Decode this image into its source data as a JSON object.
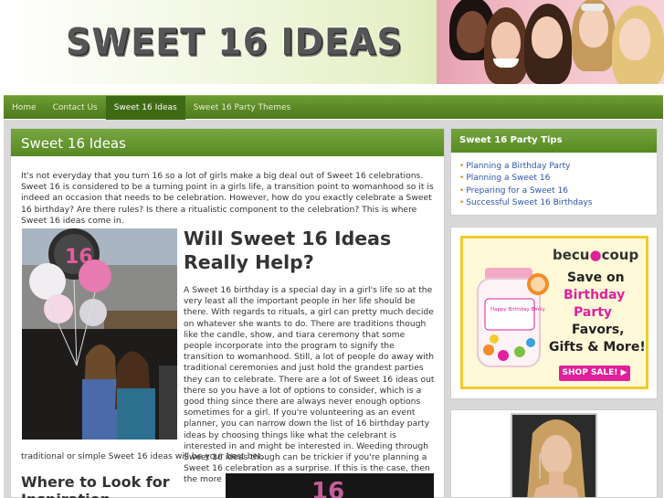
{
  "header": {
    "logo_text": "SWEET 16 IDEAS"
  },
  "nav": {
    "items": [
      {
        "label": "Home",
        "active": false
      },
      {
        "label": "Contact Us",
        "active": false
      },
      {
        "label": "Sweet 16 Ideas",
        "active": true
      },
      {
        "label": "Sweet 16 Party Themes",
        "active": false
      }
    ]
  },
  "main": {
    "title": "Sweet 16 Ideas",
    "intro": "It's not everyday that you turn 16 so a lot of girls make a big deal out of Sweet 16 celebrations. Sweet 16 is considered to be a turning point in a girls life, a transition point to womanhood so it is indeed an occasion that needs to be celebration. However, how do you exactly celebrate a Sweet 16 birthday? Are there rules? Is there a ritualistic component to the celebration? This is where Sweet 16 ideas come in.",
    "heading": "Will Sweet 16 Ideas Really Help?",
    "article": "A Sweet 16 birthday is a special day in a girl's life so at the very least all the important people in her life should be there. With regards to rituals, a girl can pretty much decide on whatever she wants to do. There are traditions though like the candle, show, and tiara ceremony that some people incorporate into the program to signify the transition to womanhood. Still, a lot of people do away with traditional ceremonies and just hold the grandest parties they can to celebrate. There are a lot of Sweet 16 ideas out there so you have a lot of options to consider, which is a good thing since there are always never enough options sometimes for a girl. If you're volunteering as an event planner, you can narrow down the list of 16 birthday party ideas by choosing things like what the celebrant is interested in and might be interested in. Weeding through Sweet 16 ideas though can be trickier if you're planning a Sweet 16 celebration as a surprise. If this is the case, then the more",
    "article_tail": "traditional or simple Sweet 16 ideas will be your best bet.",
    "subheading": "Where to Look for Inspiration"
  },
  "sidebar": {
    "tips_title": "Sweet 16 Party Tips",
    "tips": [
      "Planning a Birthday Party",
      "Planning a Sweet 16",
      "Preparing for a Sweet 16",
      "Successful Sweet 16 Birthdays"
    ],
    "ad": {
      "brand_prefix": "becu",
      "brand_suffix": "coup",
      "line1": "Save on",
      "line2": "Birthday",
      "line3": "Party",
      "line4": "Favors,",
      "line5": "Gifts & More!",
      "button": "SHOP SALE! ▶",
      "jar_label": "Happy Birthday Emily"
    }
  },
  "colors": {
    "nav_green": "#5a8a26",
    "header_green": "#6a9b33",
    "link_blue": "#2a54b8",
    "ad_pink": "#e0219b",
    "ad_yellow": "#f1cc2c"
  }
}
